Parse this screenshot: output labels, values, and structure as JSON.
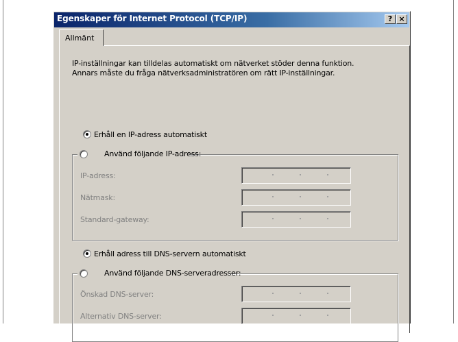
{
  "dialog": {
    "title": "Egenskaper för Internet Protocol (TCP/IP)",
    "help_button": "?",
    "close_button": "×"
  },
  "tab": {
    "label": "Allmänt"
  },
  "intro": "IP-inställningar kan tilldelas automatiskt om nätverket stöder denna funktion. Annars måste du fråga nätverksadministratören om rätt IP-inställningar.",
  "ip": {
    "auto_label": "Erhåll en IP-adress automatiskt",
    "auto_selected": true,
    "manual_label": "Använd följande IP-adress:",
    "fields": [
      {
        "label": "IP-adress:"
      },
      {
        "label": "Nätmask:"
      },
      {
        "label": "Standard-gateway:"
      }
    ]
  },
  "dns": {
    "auto_label": "Erhåll adress till DNS-servern automatiskt",
    "auto_selected": true,
    "manual_label": "Använd följande DNS-serveradresser:",
    "fields": [
      {
        "label": "Önskad DNS-server:"
      },
      {
        "label": "Alternativ DNS-server:"
      }
    ]
  }
}
